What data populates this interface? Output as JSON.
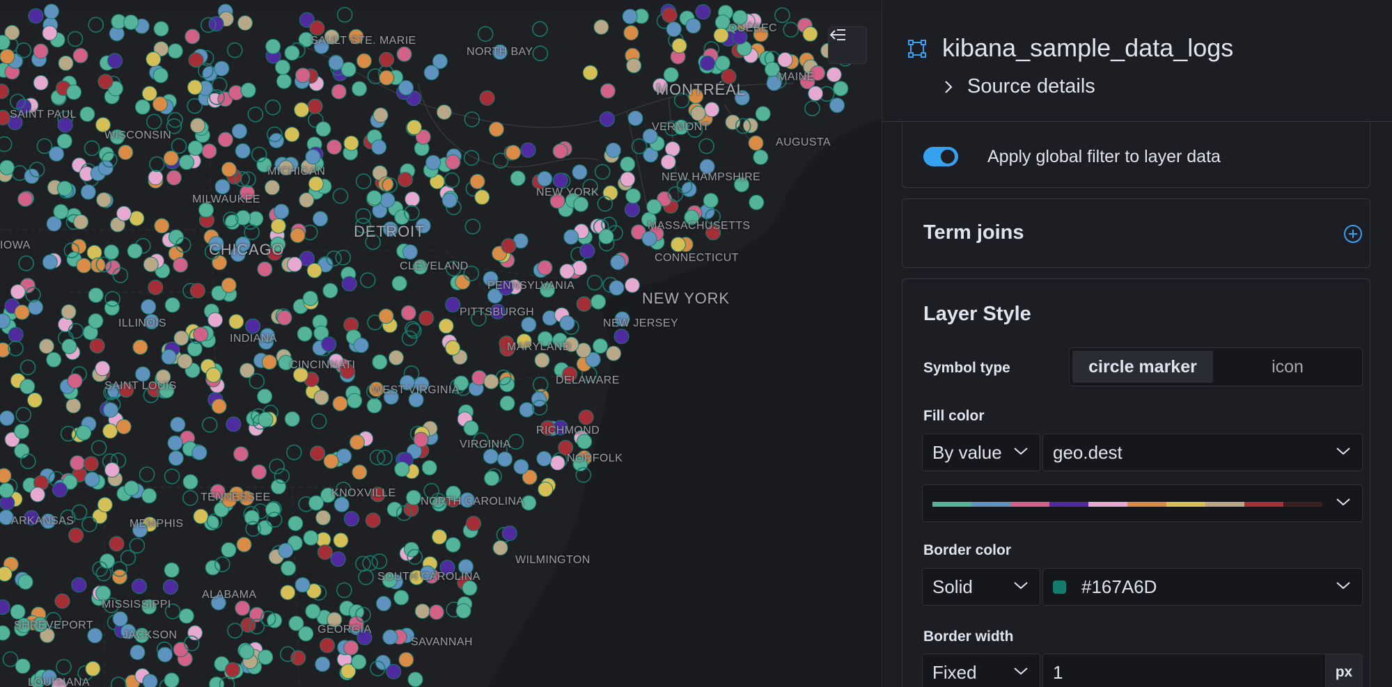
{
  "map": {
    "labels": {
      "sault_ste_marie": "SAULT STE. MARIE",
      "north_bay": "NORTH BAY",
      "quebec": "QUÉBEC",
      "montreal": "MONTRÉAL",
      "maine": "MAINE",
      "augusta": "AUGUSTA",
      "vermont": "VERMONT",
      "new_hampshire": "NEW HAMPSHIRE",
      "saint_paul": "SAINT PAUL",
      "wisconsin": "WISCONSIN",
      "michigan": "MICHIGAN",
      "milwaukee": "MILWAUKEE",
      "detroit": "DETROIT",
      "new_york_state": "NEW YORK",
      "massachusetts": "MASSACHUSETTS",
      "connecticut": "CONNECTICUT",
      "iowa": "IOWA",
      "chicago": "CHICAGO",
      "cleveland": "CLEVELAND",
      "pennsylvania": "PENNSYLVANIA",
      "new_york_city": "NEW YORK",
      "new_jersey": "NEW JERSEY",
      "illinois": "ILLINOIS",
      "pittsburgh": "PITTSBURGH",
      "indiana": "INDIANA",
      "maryland": "MARYLAND",
      "cincinnati": "CINCINNATI",
      "delaware": "DELAWARE",
      "west_virginia": "WEST VIRGINIA",
      "saint_louis": "SAINT LOUIS",
      "richmond": "RICHMOND",
      "virginia": "VIRGINIA",
      "norfolk": "NORFOLK",
      "knoxville": "KNOXVILLE",
      "tennessee": "TENNESSEE",
      "north_carolina": "NORTH CAROLINA",
      "arkansas": "ARKANSAS",
      "memphis": "MEMPHIS",
      "wilmington": "WILMINGTON",
      "south_carolina": "SOUTH CAROLINA",
      "mississippi": "MISSISSIPPI",
      "alabama": "ALABAMA",
      "georgia": "GEORGIA",
      "shreveport": "SHREVEPORT",
      "jackson": "JACKSON",
      "savannah": "SAVANNAH",
      "louisiana": "LOUISIANA"
    },
    "point_palette": [
      "#54B399",
      "#6092C0",
      "#D36086",
      "#4f2b9f",
      "#E7A9CF",
      "#DA8B45",
      "#D6BF57",
      "#B9A888",
      "#A62F37",
      "#54B399",
      "#6092C0",
      "#54B399"
    ],
    "outline_color": "#167A6D"
  },
  "panel": {
    "layer_name": "kibana_sample_data_logs",
    "source_details_label": "Source details",
    "filters": {
      "apply_global_filter_label": "Apply global filter to layer data"
    },
    "term_joins": {
      "title": "Term joins"
    },
    "layer_style": {
      "title": "Layer Style",
      "symbol_type_label": "Symbol type",
      "symbol_options": [
        "circle marker",
        "icon"
      ],
      "fill_color_label": "Fill color",
      "fill_mode": "By value",
      "fill_field": "geo.dest",
      "color_ramp": [
        "#54B399",
        "#6092C0",
        "#D36086",
        "#4f2b9f",
        "#E7A9CF",
        "#DA8B45",
        "#D6BF57",
        "#B9A888",
        "#A62F37",
        "#3a1f1f"
      ],
      "border_color_label": "Border color",
      "border_mode": "Solid",
      "border_color_value": "#167A6D",
      "border_width_label": "Border width",
      "border_width_mode": "Fixed",
      "border_width_value": "1",
      "border_width_unit": "px"
    }
  },
  "colors": {
    "accent": "#36a2ef",
    "panel_bg": "#1d1e24",
    "map_bg": "#1b1c20"
  }
}
